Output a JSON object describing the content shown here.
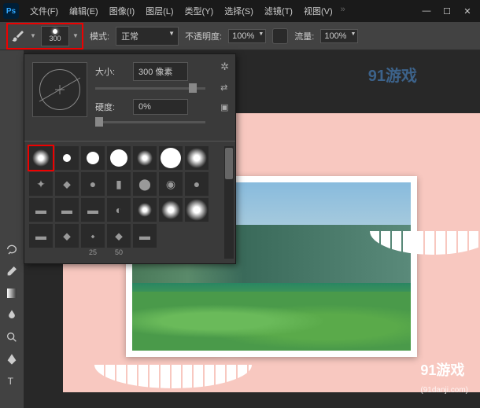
{
  "app": {
    "logo": "Ps"
  },
  "menu": {
    "items": [
      "文件(F)",
      "编辑(E)",
      "图像(I)",
      "图层(L)",
      "类型(Y)",
      "选择(S)",
      "滤镜(T)",
      "视图(V)"
    ],
    "overflow": "»"
  },
  "win": {
    "min": "—",
    "max": "☐",
    "close": "✕"
  },
  "optbar": {
    "brush_size_num": "300",
    "mode_label": "模式:",
    "mode_value": "正常",
    "opacity_label": "不透明度:",
    "opacity_value": "100%",
    "flow_label": "流量:",
    "flow_value": "100%"
  },
  "panel": {
    "size_label": "大小:",
    "size_value": "300 像素",
    "hardness_label": "硬度:",
    "hardness_value": "0%",
    "gear": "✲",
    "flip": "⇄",
    "presets_row4_labels": [
      "25",
      "50"
    ]
  },
  "watermark": {
    "top": "91游戏",
    "bottom_main": "91游戏",
    "bottom_sub": "(91danji.com)"
  }
}
